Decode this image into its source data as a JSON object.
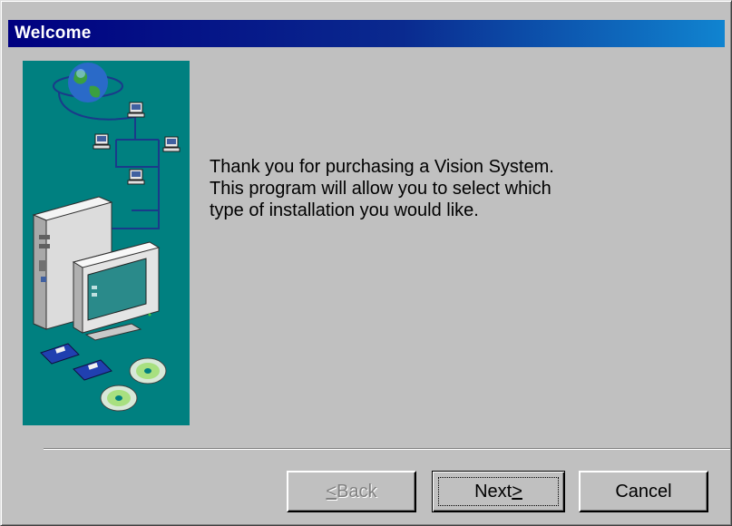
{
  "window": {
    "title": "Welcome"
  },
  "main": {
    "intro_lines": [
      "Thank you for purchasing a Vision System.",
      "This program will allow you to select which",
      "type of installation you would like."
    ]
  },
  "buttons": {
    "back": {
      "label_prefix": "",
      "mnemonic": "<",
      "label_rest": "Back",
      "enabled": false
    },
    "next": {
      "label_prefix": "Next",
      "mnemonic": ">",
      "label_rest": "",
      "enabled": true,
      "default": true
    },
    "cancel": {
      "label": "Cancel",
      "enabled": true
    }
  },
  "colors": {
    "dialog_face": "#c0c0c0",
    "title_start": "#000080",
    "title_end": "#1084d0",
    "side_image_bg": "#008080"
  },
  "side_image": {
    "icons": [
      "globe-icon",
      "network-computer-icon",
      "desktop-computer-icon",
      "monitor-icon",
      "floppy-disk-icon",
      "cd-rom-icon"
    ]
  }
}
